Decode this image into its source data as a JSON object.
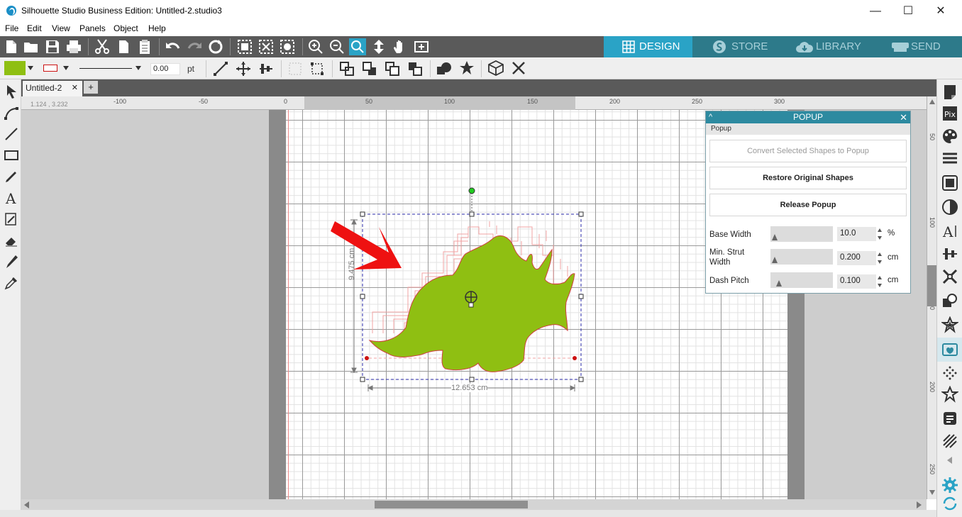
{
  "window": {
    "title": "Silhouette Studio Business Edition: Untitled-2.studio3",
    "minimize": "—",
    "maximize": "☐",
    "close": "✕"
  },
  "menu": [
    "File",
    "Edit",
    "View",
    "Panels",
    "Object",
    "Help"
  ],
  "top_tabs": [
    {
      "label": "DESIGN",
      "icon": "grid-icon",
      "active": true
    },
    {
      "label": "STORE",
      "icon": "silhouette-s-icon",
      "active": false
    },
    {
      "label": "LIBRARY",
      "icon": "cloud-icon",
      "active": false
    },
    {
      "label": "SEND",
      "icon": "cutter-icon",
      "active": false
    }
  ],
  "colors": {
    "accent": "#2d8aa0",
    "active_tab": "#2aa3c6",
    "fill_color": "#8fbf12",
    "line_color": "#cc1111",
    "shape_fill": "#8fbf12"
  },
  "style_bar": {
    "line_width": "0.00",
    "line_width_unit": "pt"
  },
  "document": {
    "tab_label": "Untitled-2",
    "tab_close": "✕",
    "add_tab": "+"
  },
  "ruler": {
    "coords": "1.124 , 3.232",
    "h_labels": [
      "-100",
      "-50",
      "0",
      "50",
      "100",
      "150",
      "200",
      "250",
      "300"
    ],
    "v_labels": [
      "50",
      "100",
      "150",
      "200",
      "250"
    ]
  },
  "selection": {
    "height_label": "9.475 cm",
    "width_label": "12.653 cm"
  },
  "popup_panel": {
    "title": "POPUP",
    "collapse_icon": "^",
    "close_icon": "✕",
    "section_label": "Popup",
    "buttons": [
      {
        "label": "Convert Selected Shapes to Popup",
        "enabled": false
      },
      {
        "label": "Restore Original Shapes",
        "enabled": true
      },
      {
        "label": "Release Popup",
        "enabled": true
      }
    ],
    "params": [
      {
        "label": "Base Width",
        "value": "10.0",
        "unit": "%"
      },
      {
        "label": "Min. Strut Width",
        "value": "0.200",
        "unit": "cm"
      },
      {
        "label": "Dash Pitch",
        "value": "0.100",
        "unit": "cm"
      }
    ]
  }
}
